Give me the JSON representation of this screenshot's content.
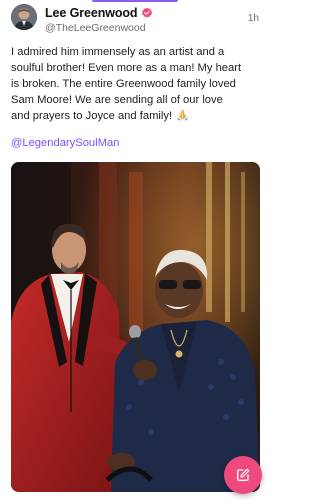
{
  "post": {
    "author": {
      "display_name": "Lee Greenwood",
      "handle": "@TheLeeGreenwood",
      "verified": true,
      "avatar_icon": "avatar-photo"
    },
    "timestamp": "1h",
    "text_lines": [
      "I admired him immensely as an artist and a",
      "soulful brother! Even more as a man! My heart",
      "is broken. The entire Greenwood family loved",
      "Sam Moore! We are sending all of our love",
      "and prayers to Joyce and family!"
    ],
    "emoji": "🙏",
    "mention": "@LegendarySoulMan",
    "image_icon": "concert-photo"
  },
  "compose_button": {
    "icon": "edit-icon"
  },
  "colors": {
    "accent": "#8b5cf6",
    "mention": "#7c4dff",
    "verified_badge": "#ee4a7e",
    "fab": "#ee4a7e"
  }
}
